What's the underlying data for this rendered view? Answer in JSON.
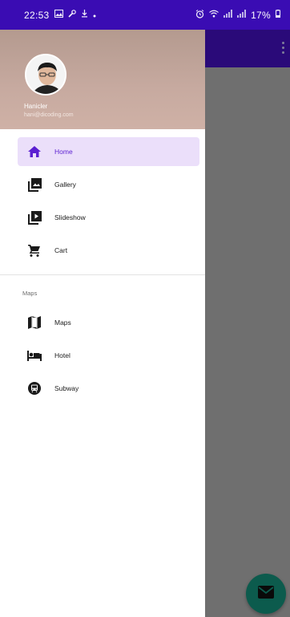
{
  "status_bar": {
    "time": "22:53",
    "icons_left": [
      "image-icon",
      "wrench-icon",
      "download-icon",
      "dot-icon"
    ],
    "icons_right": [
      "alarm-icon",
      "wifi-icon",
      "signal-icon",
      "signal-icon"
    ],
    "battery": "17%"
  },
  "drawer": {
    "header": {
      "name": "Hanicler",
      "email": "hani@dicoding.com"
    },
    "items": [
      {
        "label": "Home",
        "icon": "home-icon",
        "active": true
      },
      {
        "label": "Gallery",
        "icon": "gallery-icon",
        "active": false
      },
      {
        "label": "Slideshow",
        "icon": "slideshow-icon",
        "active": false
      },
      {
        "label": "Cart",
        "icon": "cart-icon",
        "active": false
      }
    ],
    "section_title": "Maps",
    "section_items": [
      {
        "label": "Maps",
        "icon": "map-icon"
      },
      {
        "label": "Hotel",
        "icon": "hotel-icon"
      },
      {
        "label": "Subway",
        "icon": "subway-icon"
      }
    ]
  },
  "colors": {
    "status_bar": "#3a0cb3",
    "app_bar": "#2a0a79",
    "active_item_bg": "#ebdffa",
    "active_item_text": "#5b1fd1",
    "fab": "#0c5b4d"
  }
}
